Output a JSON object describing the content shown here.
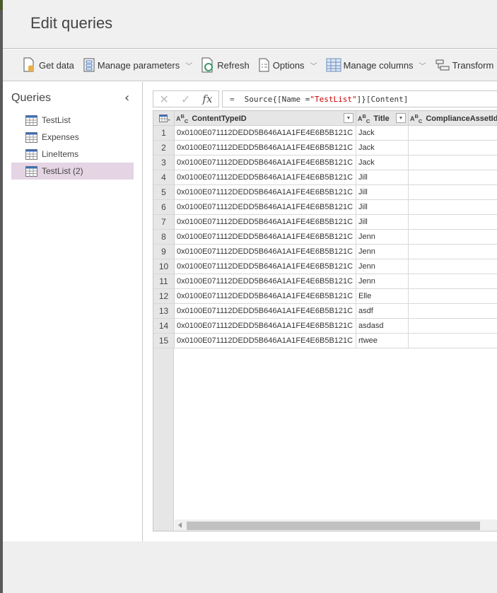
{
  "dialog": {
    "title": "Edit queries"
  },
  "toolbar": [
    {
      "label": "Get data",
      "icon": "get-data-icon",
      "dropdown": false
    },
    {
      "label": "Manage parameters",
      "icon": "manage-parameters-icon",
      "dropdown": true
    },
    {
      "label": "Refresh",
      "icon": "refresh-icon",
      "dropdown": false
    },
    {
      "label": "Options",
      "icon": "options-icon",
      "dropdown": true
    },
    {
      "label": "Manage columns",
      "icon": "manage-columns-icon",
      "dropdown": true
    },
    {
      "label": "Transform",
      "icon": "transform-icon",
      "dropdown": false
    }
  ],
  "queries": {
    "title": "Queries",
    "items": [
      {
        "label": "TestList",
        "selected": false
      },
      {
        "label": "Expenses",
        "selected": false
      },
      {
        "label": "LineItems",
        "selected": false
      },
      {
        "label": "TestList (2)",
        "selected": true
      }
    ]
  },
  "formula": {
    "eq": "=",
    "prefix": "Source{[Name = ",
    "string": "\"TestList\"",
    "suffix": "]}[Content]"
  },
  "grid": {
    "columns": [
      "ContentTypeID",
      "Title",
      "ComplianceAssetId"
    ],
    "rows": [
      [
        "1",
        "0x0100E071112DEDD5B646A1A1FE4E6B5B121C",
        "Jack",
        ""
      ],
      [
        "2",
        "0x0100E071112DEDD5B646A1A1FE4E6B5B121C",
        "Jack",
        ""
      ],
      [
        "3",
        "0x0100E071112DEDD5B646A1A1FE4E6B5B121C",
        "Jack",
        ""
      ],
      [
        "4",
        "0x0100E071112DEDD5B646A1A1FE4E6B5B121C",
        "Jill",
        ""
      ],
      [
        "5",
        "0x0100E071112DEDD5B646A1A1FE4E6B5B121C",
        "Jill",
        ""
      ],
      [
        "6",
        "0x0100E071112DEDD5B646A1A1FE4E6B5B121C",
        "Jill",
        ""
      ],
      [
        "7",
        "0x0100E071112DEDD5B646A1A1FE4E6B5B121C",
        "Jill",
        ""
      ],
      [
        "8",
        "0x0100E071112DEDD5B646A1A1FE4E6B5B121C",
        "Jenn",
        ""
      ],
      [
        "9",
        "0x0100E071112DEDD5B646A1A1FE4E6B5B121C",
        "Jenn",
        ""
      ],
      [
        "10",
        "0x0100E071112DEDD5B646A1A1FE4E6B5B121C",
        "Jenn",
        ""
      ],
      [
        "11",
        "0x0100E071112DEDD5B646A1A1FE4E6B5B121C",
        "Jenn",
        ""
      ],
      [
        "12",
        "0x0100E071112DEDD5B646A1A1FE4E6B5B121C",
        "Elle",
        ""
      ],
      [
        "13",
        "0x0100E071112DEDD5B646A1A1FE4E6B5B121C",
        "asdf",
        ""
      ],
      [
        "14",
        "0x0100E071112DEDD5B646A1A1FE4E6B5B121C",
        "asdasd",
        ""
      ],
      [
        "15",
        "0x0100E071112DEDD5B646A1A1FE4E6B5B121C",
        "rtwee",
        ""
      ]
    ]
  },
  "colors": {
    "selected": "#e4d4e4",
    "table_icon": "#3b6fb6",
    "string": "#cc0000"
  }
}
